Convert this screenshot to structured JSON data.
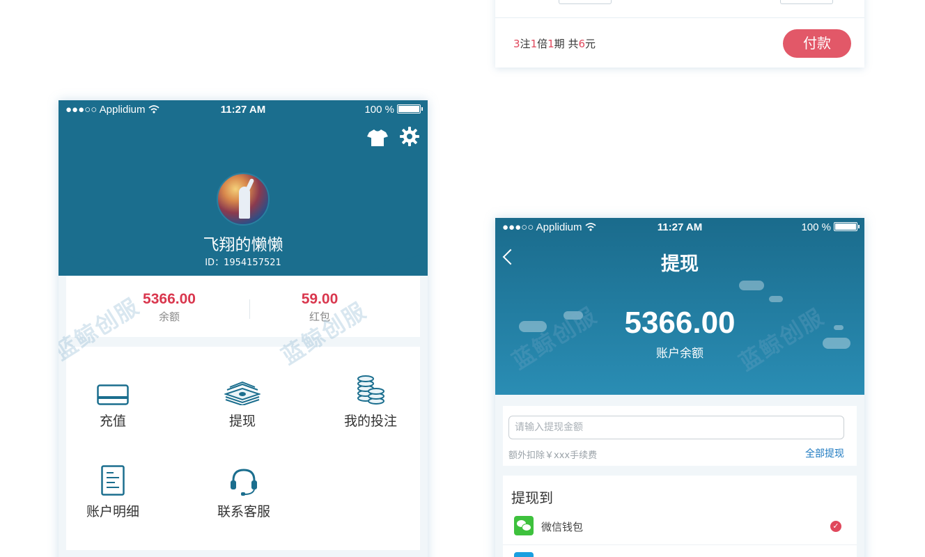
{
  "top_card": {
    "summary": {
      "bets": "3",
      "bets_unit": "注",
      "multiple": "1",
      "multiple_unit": "倍",
      "periods": "1",
      "periods_unit": "期 共",
      "total": "6",
      "total_unit": "元"
    },
    "pay_label": "付款"
  },
  "status_bar": {
    "carrier": "●●●○○ Applidium",
    "wifi_icon": "wifi-icon",
    "time": "11:27 AM",
    "battery": "100 %"
  },
  "profile": {
    "username": "飞翔的懒懒",
    "user_id": "ID：1954157521",
    "balance_value": "5366.00",
    "balance_label": "余额",
    "redpacket_value": "59.00",
    "redpacket_label": "红包",
    "header_icons": [
      "tshirt-icon",
      "gear-icon"
    ],
    "menu": [
      {
        "label": "充值",
        "icon": "card-icon"
      },
      {
        "label": "提现",
        "icon": "cash-stack-icon"
      },
      {
        "label": "我的投注",
        "icon": "coins-icon"
      },
      {
        "label": "账户明细",
        "icon": "document-icon"
      },
      {
        "label": "联系客服",
        "icon": "headset-icon"
      }
    ]
  },
  "watermark": "蓝鲸创服",
  "withdraw": {
    "title": "提现",
    "amount": "5366.00",
    "amount_label": "账户余额",
    "input_placeholder": "请输入提现金额",
    "fee_note": "额外扣除￥xxx手续费",
    "withdraw_all": "全部提现",
    "target_title": "提现到",
    "wallet_label": "微信钱包"
  },
  "colors": {
    "header_blue": "#1b6e8e",
    "accent_red": "#e25868",
    "value_red": "#d9374e",
    "link_blue": "#1d79c0"
  }
}
